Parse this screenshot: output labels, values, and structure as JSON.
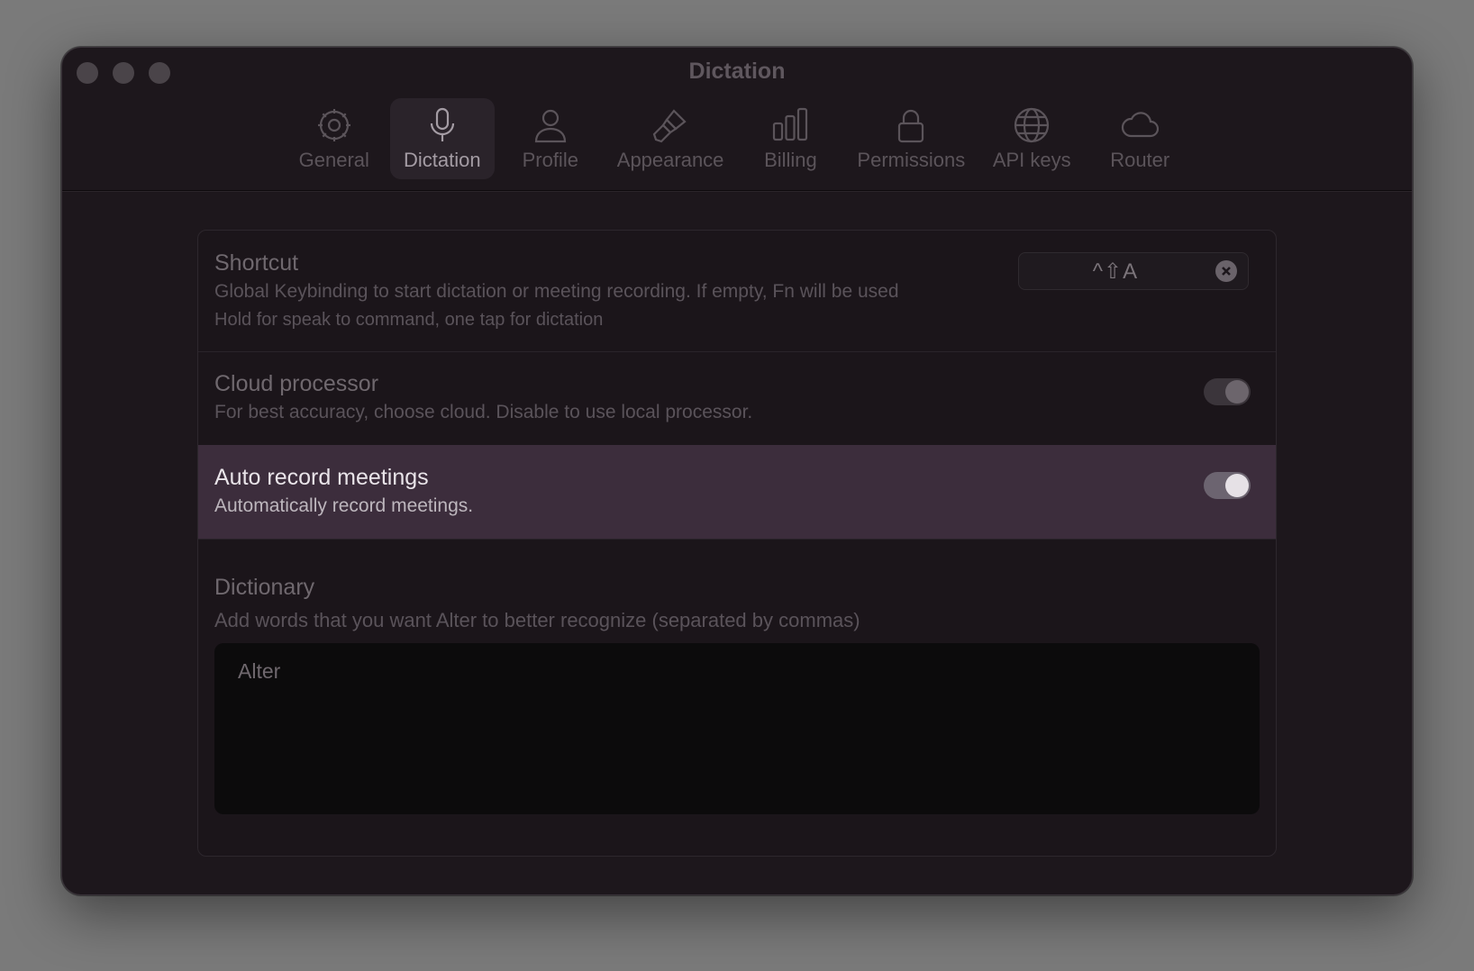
{
  "window": {
    "title": "Dictation"
  },
  "tabs": [
    {
      "label": "General",
      "icon": "gear-icon",
      "active": false
    },
    {
      "label": "Dictation",
      "icon": "microphone-icon",
      "active": true
    },
    {
      "label": "Profile",
      "icon": "person-icon",
      "active": false
    },
    {
      "label": "Appearance",
      "icon": "paintbrush-icon",
      "active": false
    },
    {
      "label": "Billing",
      "icon": "bar-chart-icon",
      "active": false
    },
    {
      "label": "Permissions",
      "icon": "lock-icon",
      "active": false
    },
    {
      "label": "API keys",
      "icon": "globe-icon",
      "active": false
    },
    {
      "label": "Router",
      "icon": "cloud-icon",
      "active": false
    }
  ],
  "settings": {
    "shortcut": {
      "title": "Shortcut",
      "description": "Global Keybinding to start dictation or meeting recording. If empty, Fn will be used",
      "hint": "Hold for speak to command, one tap for dictation",
      "keys": "^⇧A"
    },
    "cloud_processor": {
      "title": "Cloud processor",
      "description": "For best accuracy, choose cloud. Disable to use local processor.",
      "enabled": true
    },
    "auto_record": {
      "title": "Auto record meetings",
      "description": "Automatically record meetings.",
      "enabled": true
    },
    "dictionary": {
      "title": "Dictionary",
      "description": "Add words that you want Alter to better recognize (separated by commas)",
      "value": "Alter"
    }
  },
  "colors": {
    "background": "#1d171c",
    "highlight_row": "#3c2d3c"
  }
}
